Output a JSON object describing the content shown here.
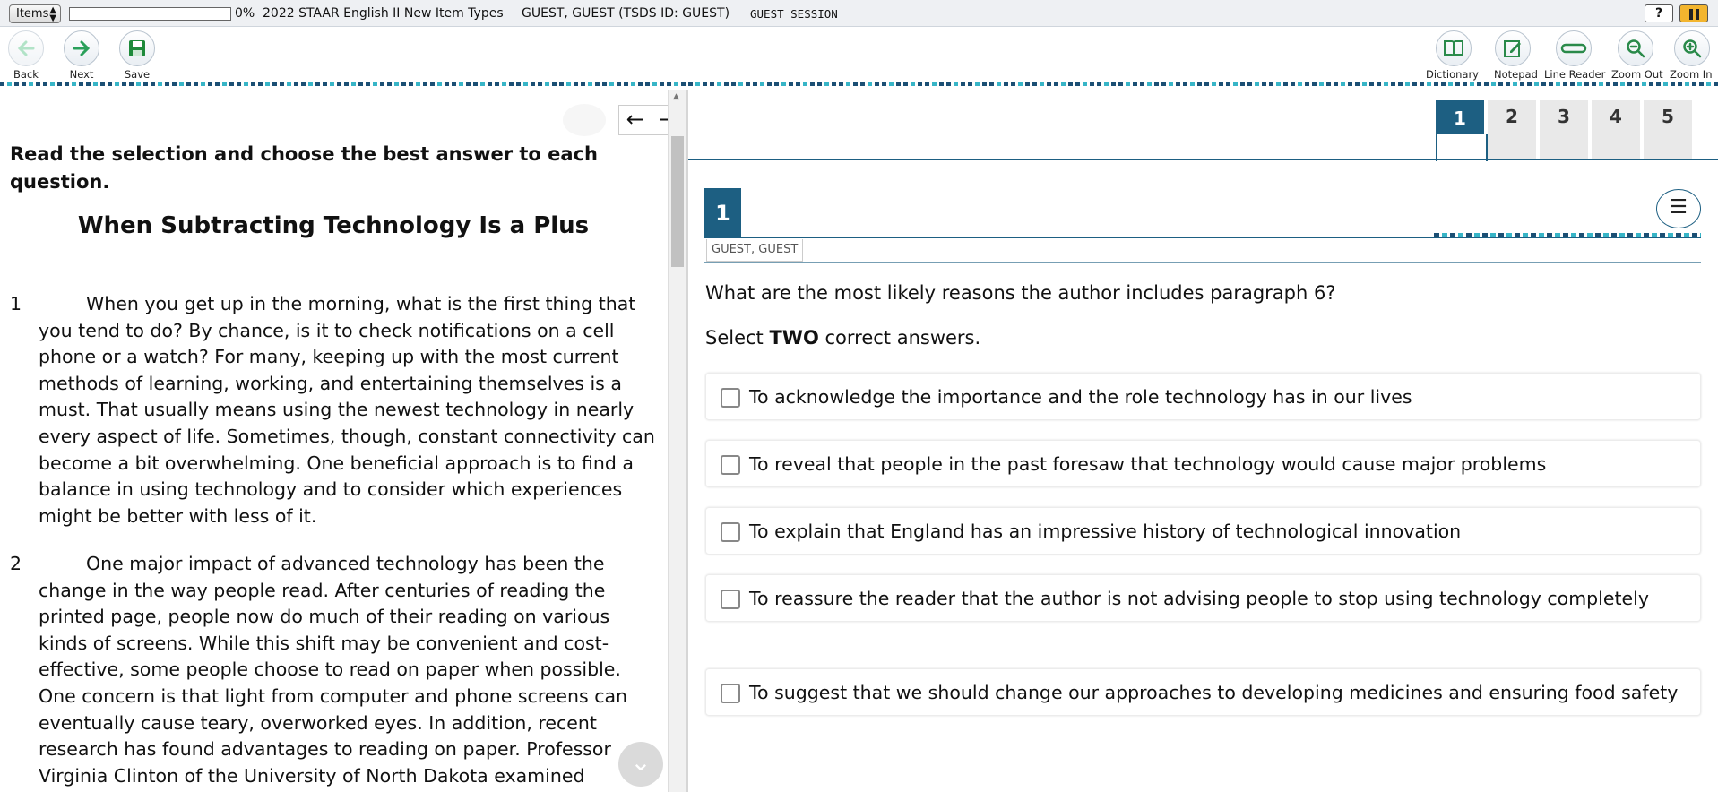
{
  "topbar": {
    "items_label": "Items",
    "progress_percent": 0,
    "progress_text": "0%",
    "test_name": "2022 STAAR English II New Item Types",
    "student": "GUEST, GUEST (TSDS ID: GUEST)",
    "session": "GUEST SESSION",
    "help_label": "?"
  },
  "toolbar": {
    "back": "Back",
    "next": "Next",
    "save": "Save",
    "dictionary": "Dictionary",
    "notepad": "Notepad",
    "line_reader": "Line Reader",
    "zoom_out": "Zoom Out",
    "zoom_in": "Zoom In"
  },
  "passage": {
    "instructions": "Read the selection and choose the best answer to each question.",
    "title": "When Subtracting Technology Is a Plus",
    "paragraphs": [
      {
        "num": "1",
        "text": "When you get up in the morning, what is the first thing that you tend to do? By chance, is it to check notifications on a cell phone or a watch? For many, keeping up with the most current methods of learning, working, and entertaining themselves is a must. That usually means using the newest technology in nearly every aspect of life. Sometimes, though, constant connectivity can become a bit overwhelming. One beneficial approach is to find a balance in using technology and to consider which experiences might be better with less of it."
      },
      {
        "num": "2",
        "text": "One major impact of advanced technology has been the change in the way people read. After centuries of reading the printed page, people now do much of their reading on various kinds of screens. While this shift may be convenient and cost-effective, some people choose to read on paper when possible. One concern is that light from computer and phone screens can eventually cause teary, overworked eyes. In addition, recent research has found advantages to reading on paper. Professor Virginia Clinton of the University of North Dakota examined"
      }
    ]
  },
  "question_tabs": [
    "1",
    "2",
    "3",
    "4",
    "5"
  ],
  "question": {
    "number": "1",
    "student_tag": "GUEST, GUEST",
    "stem": "What are the most likely reasons the author includes paragraph 6?",
    "select_prefix": "Select ",
    "select_bold": "TWO",
    "select_suffix": " correct answers.",
    "choices": [
      "To acknowledge the importance and the role technology has in our lives",
      "To reveal that people in the past foresaw that technology would cause major problems",
      "To explain that England has an impressive history of technological innovation",
      "To reassure the reader that the author is not advising people to stop using technology completely",
      "To suggest that we should change our approaches to developing medicines and ensuring food safety"
    ]
  },
  "colors": {
    "accent": "#1d5f82",
    "next_green": "#2aa05a",
    "save_green": "#1e8a3a",
    "pause": "#f3b52e"
  }
}
